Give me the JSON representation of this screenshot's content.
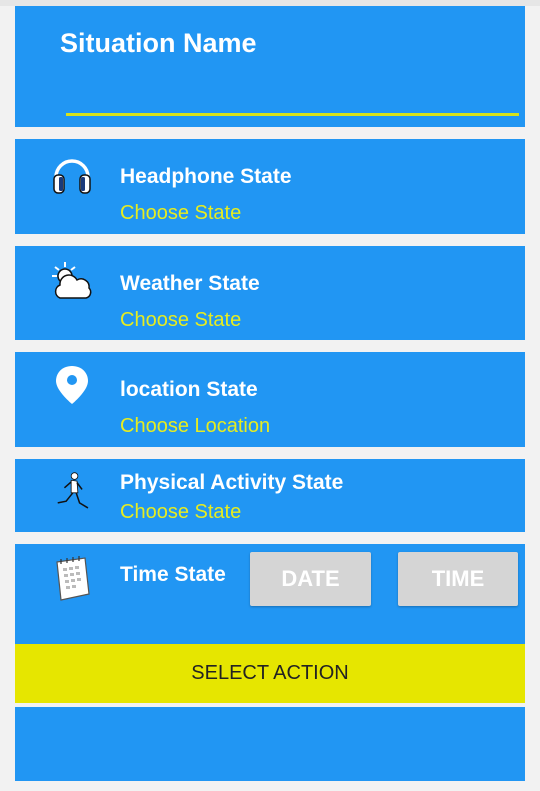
{
  "situation": {
    "title": "Situation Name"
  },
  "states": {
    "headphone": {
      "title": "Headphone State",
      "action": "Choose State",
      "icon": "headphone-icon"
    },
    "weather": {
      "title": "Weather State",
      "action": "Choose State",
      "icon": "weather-icon"
    },
    "location": {
      "title": "location State",
      "action": "Choose Location",
      "icon": "location-pin-icon"
    },
    "activity": {
      "title": "Physical Activity State",
      "action": "Choose State",
      "icon": "runner-icon"
    },
    "time": {
      "title": "Time State",
      "icon": "calendar-icon",
      "date_label": "DATE",
      "time_label": "TIME"
    }
  },
  "actions": {
    "select_action_label": "SELECT ACTION"
  },
  "colors": {
    "card_blue": "#2196f3",
    "accent_yellow": "#e6ec20",
    "button_yellow": "#e6e600",
    "button_gray": "#d5d5d5"
  }
}
